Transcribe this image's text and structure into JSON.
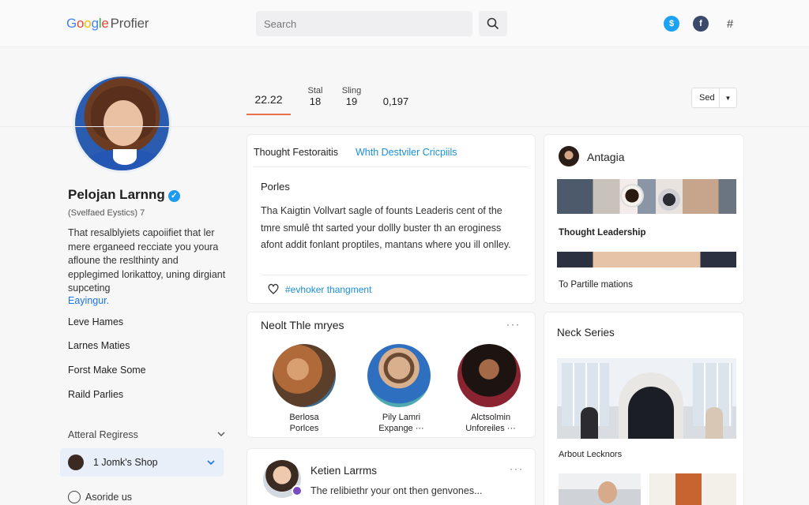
{
  "header": {
    "logo_letters": [
      "G",
      "o",
      "o",
      "g",
      "l",
      "e"
    ],
    "logo_suffix": "Profier",
    "search_placeholder": "Search",
    "icons": [
      "search-icon",
      "twitter-icon",
      "facebook-icon",
      "grid-icon"
    ],
    "icon_glyphs": [
      "$",
      "f",
      "#"
    ]
  },
  "profile": {
    "name": "Pelojan Larnng",
    "verified_glyph": "✓",
    "subtitle": "(Svelfaed Eystics) 7",
    "bio": "That resalblyiets capoiifiet that ler mere erganeed recciate you youra afloune the reslthinty and epplegimed lorikattoy, uning dirgiant supceting",
    "bio_link": "Eayingur.",
    "links": [
      "Leve Hames",
      "Larnes Maties",
      "Forst Make Some",
      "Raild Parlies"
    ],
    "accordion_label": "Atteral Regiress",
    "shop_label": "1 Jomk's Shop",
    "about_label": "Asoride us"
  },
  "stats": {
    "main": "22.22",
    "items": [
      {
        "label": "Stal",
        "value": "18"
      },
      {
        "label": "Sling",
        "value": "19"
      },
      {
        "label": "",
        "value": "0,197"
      }
    ],
    "sed_label": "Sed"
  },
  "feed": {
    "tabs": [
      "Thought Festoraitis",
      "Whth Destviler Cricpiils"
    ],
    "posts_title": "Porles",
    "post_text": "Tha Kaigtin Vollvart sagle of founts Leaderis cent of the tmre smulê tht sarted your dollly buster th an eroginess afont addit fonlant proptiles, mantans where you ill onlley.",
    "hashtag": "#evhoker thangment",
    "people_title": "Neolt Thle mryes",
    "people": [
      {
        "line1": "Berlosa",
        "line2": "Porlces"
      },
      {
        "line1": "Pily Lamri",
        "line2": "Expange ···"
      },
      {
        "line1": "Alctsolmin",
        "line2": "Unforeiles ···"
      }
    ],
    "author_name": "Ketien Larrms",
    "author_text": "The relibiethr your ont then genvones...",
    "more_glyph": "···"
  },
  "right": {
    "card1_title": "Antagia",
    "card1_caption1": "Thought Leadership",
    "card1_caption2": "To Partille mations",
    "card2_title": "Neck Series",
    "card2_caption": "Arbout Lecknors"
  }
}
